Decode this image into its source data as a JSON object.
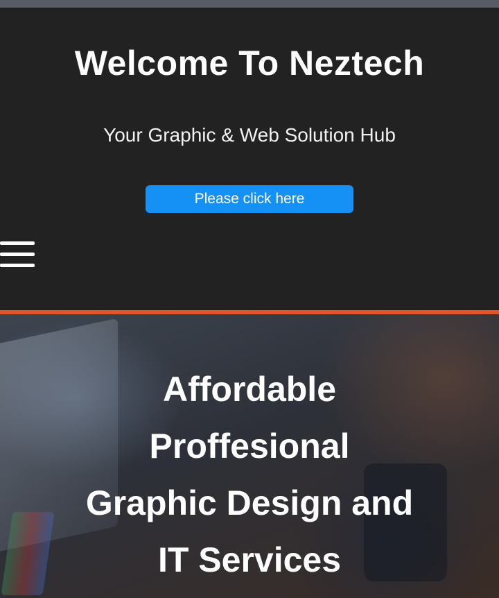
{
  "header": {
    "title": "Welcome To Neztech",
    "tagline": "Your Graphic & Web Solution Hub",
    "cta_label": "Please click here"
  },
  "menu": {
    "icon": "hamburger-menu-icon"
  },
  "hero": {
    "lines": [
      "Affordable",
      "Proffesional",
      "Graphic Design and",
      "IT Services"
    ]
  },
  "colors": {
    "header_background": "#222222",
    "top_strip": "#565b66",
    "button": "#1590f5",
    "accent_line": "#e4532f",
    "text": "#ffffff"
  }
}
